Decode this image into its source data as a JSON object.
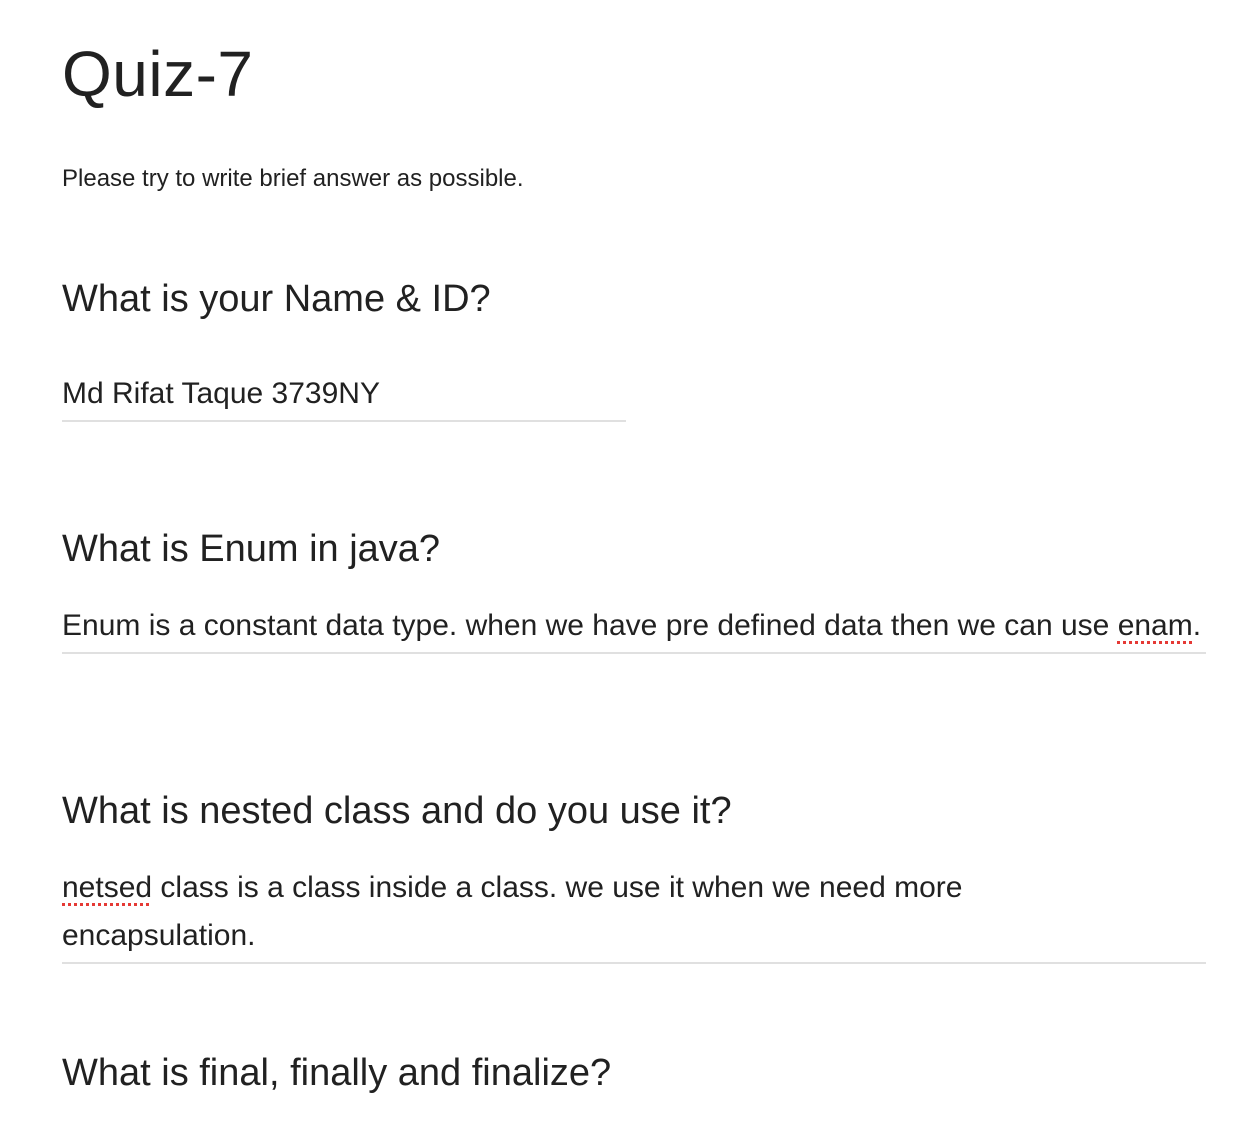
{
  "form": {
    "title": "Quiz-7",
    "description": "Please try to write brief answer as possible."
  },
  "questions": [
    {
      "title": "What is your Name & ID?",
      "answer": "Md Rifat Taque 3739NY"
    },
    {
      "title": "What is Enum in java?",
      "answer_text": "Enum is a constant data type. when we have pre defined data then we can use ",
      "answer_misspelled": "enam",
      "answer_tail": "."
    },
    {
      "title": "What is nested class and do you use it?",
      "answer_misspelled": "netsed",
      "answer_text": " class is a class inside a class. we use it when we need more encapsulation."
    },
    {
      "title": "What is final, finally and finalize?"
    }
  ],
  "colors": {
    "text": "#212121",
    "underline": "#e0e0e0",
    "spellcheck": "#e53935"
  }
}
